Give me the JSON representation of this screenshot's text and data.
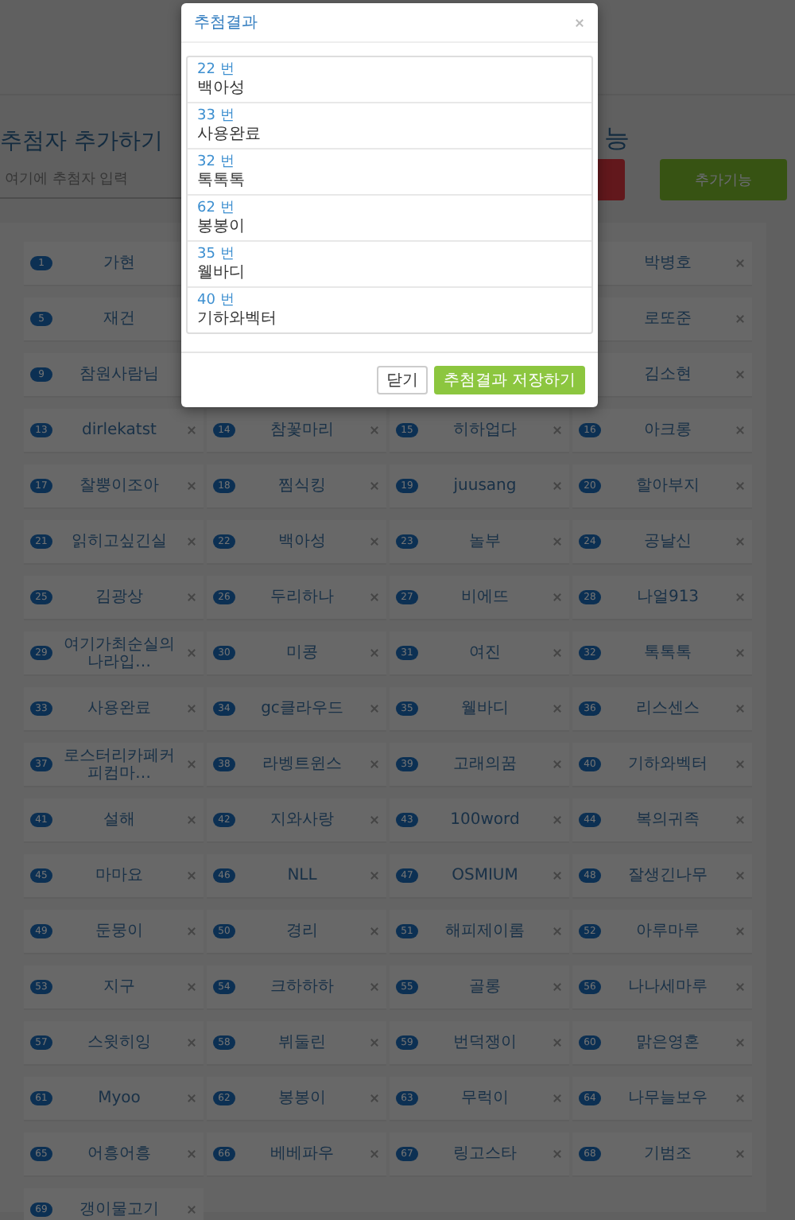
{
  "page": {
    "heading": "추첨자 추가하기",
    "heading_tail": "능",
    "input": {
      "placeholder": "여기에 추첨자 입력"
    },
    "add_feature_button": "추가기능"
  },
  "grid": {
    "rows": [
      {
        "cells": [
          {
            "number": "1",
            "name": "가현"
          },
          null,
          null,
          {
            "name": "박병호"
          }
        ]
      },
      {
        "cells": [
          {
            "number": "5",
            "name": "재건"
          },
          null,
          null,
          {
            "name": "로또준"
          }
        ]
      },
      {
        "cells": [
          {
            "number": "9",
            "name": "참원사람님"
          },
          null,
          null,
          {
            "name": "김소현"
          }
        ]
      },
      {
        "cells": [
          {
            "number": "13",
            "name": "dirlekatst"
          },
          {
            "number": "14",
            "name": "참꽃마리"
          },
          {
            "number": "15",
            "name": "히하업다"
          },
          {
            "number": "16",
            "name": "아크롱"
          }
        ]
      },
      {
        "cells": [
          {
            "number": "17",
            "name": "찰뿡이조아"
          },
          {
            "number": "18",
            "name": "찜식킹"
          },
          {
            "number": "19",
            "name": "juusang"
          },
          {
            "number": "20",
            "name": "할아부지"
          }
        ]
      },
      {
        "cells": [
          {
            "number": "21",
            "name": "읽히고싶긴실"
          },
          {
            "number": "22",
            "name": "백아성"
          },
          {
            "number": "23",
            "name": "놀부"
          },
          {
            "number": "24",
            "name": "공날신"
          }
        ]
      },
      {
        "cells": [
          {
            "number": "25",
            "name": "김광상"
          },
          {
            "number": "26",
            "name": "두리하나"
          },
          {
            "number": "27",
            "name": "비에뜨"
          },
          {
            "number": "28",
            "name": "나얼913"
          }
        ]
      },
      {
        "cells": [
          {
            "number": "29",
            "name": "여기가최순실의나라입…"
          },
          {
            "number": "30",
            "name": "미콩"
          },
          {
            "number": "31",
            "name": "여진"
          },
          {
            "number": "32",
            "name": "톡톡톡"
          }
        ]
      },
      {
        "cells": [
          {
            "number": "33",
            "name": "사용완료"
          },
          {
            "number": "34",
            "name": "gc클라우드"
          },
          {
            "number": "35",
            "name": "웰바디"
          },
          {
            "number": "36",
            "name": "리스센스"
          }
        ]
      },
      {
        "cells": [
          {
            "number": "37",
            "name": "로스터리카페커피컴마…"
          },
          {
            "number": "38",
            "name": "라벵트윈스"
          },
          {
            "number": "39",
            "name": "고래의꿈"
          },
          {
            "number": "40",
            "name": "기하와벡터"
          }
        ]
      },
      {
        "cells": [
          {
            "number": "41",
            "name": "설해"
          },
          {
            "number": "42",
            "name": "지와사랑"
          },
          {
            "number": "43",
            "name": "100word"
          },
          {
            "number": "44",
            "name": "복의귀족"
          }
        ]
      },
      {
        "cells": [
          {
            "number": "45",
            "name": "마마요"
          },
          {
            "number": "46",
            "name": "NLL"
          },
          {
            "number": "47",
            "name": "OSMIUM"
          },
          {
            "number": "48",
            "name": "잘생긴나무"
          }
        ]
      },
      {
        "cells": [
          {
            "number": "49",
            "name": "둔뭉이"
          },
          {
            "number": "50",
            "name": "경리"
          },
          {
            "number": "51",
            "name": "해피제이롬"
          },
          {
            "number": "52",
            "name": "아루마루"
          }
        ]
      },
      {
        "cells": [
          {
            "number": "53",
            "name": "지구"
          },
          {
            "number": "54",
            "name": "크하하하"
          },
          {
            "number": "55",
            "name": "골롱"
          },
          {
            "number": "56",
            "name": "나나세마루"
          }
        ]
      },
      {
        "cells": [
          {
            "number": "57",
            "name": "스윗히잉"
          },
          {
            "number": "58",
            "name": "뷔둘린"
          },
          {
            "number": "59",
            "name": "번덕쟁이"
          },
          {
            "number": "60",
            "name": "맑은영혼"
          }
        ]
      },
      {
        "cells": [
          {
            "number": "61",
            "name": "Myoo"
          },
          {
            "number": "62",
            "name": "봉봉이"
          },
          {
            "number": "63",
            "name": "무럭이"
          },
          {
            "number": "64",
            "name": "나무늘보우"
          }
        ]
      },
      {
        "cells": [
          {
            "number": "65",
            "name": "어흥어흥"
          },
          {
            "number": "66",
            "name": "베베파우"
          },
          {
            "number": "67",
            "name": "링고스타"
          },
          {
            "number": "68",
            "name": "기범조"
          }
        ]
      },
      {
        "cells": [
          {
            "number": "69",
            "name": "갱이물고기"
          }
        ]
      }
    ]
  },
  "modal": {
    "title": "추첨결과",
    "results": [
      {
        "number": "22 번",
        "name": "백아성"
      },
      {
        "number": "33 번",
        "name": "사용완료"
      },
      {
        "number": "32 번",
        "name": "톡톡톡"
      },
      {
        "number": "62 번",
        "name": "봉봉이"
      },
      {
        "number": "35 번",
        "name": "웰바디"
      },
      {
        "number": "40 번",
        "name": "기하와벡터"
      }
    ],
    "buttons": [
      {
        "kind": "default",
        "label": "닫기"
      },
      {
        "kind": "primary",
        "label": "추첨결과 저장하기"
      }
    ]
  }
}
